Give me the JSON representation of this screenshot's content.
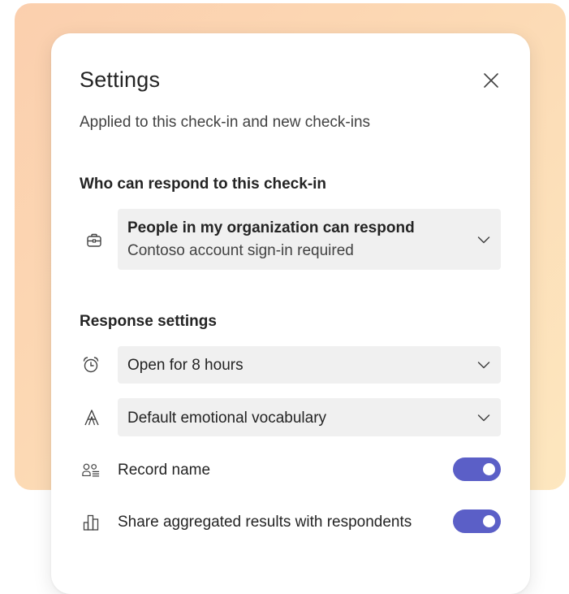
{
  "dialog": {
    "title": "Settings",
    "subtitle": "Applied to this check-in and new check-ins"
  },
  "who_can_respond": {
    "heading": "Who can respond to this check-in",
    "audience": {
      "icon": "briefcase-icon",
      "primary": "People in my organization can respond",
      "secondary": "Contoso account sign-in required"
    }
  },
  "response_settings": {
    "heading": "Response settings",
    "duration": {
      "icon": "alarm-clock-icon",
      "value": "Open for 8 hours"
    },
    "vocabulary": {
      "icon": "text-font-icon",
      "value": "Default emotional vocabulary"
    },
    "record_name": {
      "icon": "people-list-icon",
      "label": "Record name",
      "enabled": true
    },
    "share_results": {
      "icon": "bar-chart-icon",
      "label": "Share aggregated results with respondents",
      "enabled": true
    }
  },
  "colors": {
    "toggle_on": "#5b5fc7",
    "select_bg": "#f0f0f0",
    "backdrop_from": "#fbcfae",
    "backdrop_to": "#fde7bf"
  }
}
